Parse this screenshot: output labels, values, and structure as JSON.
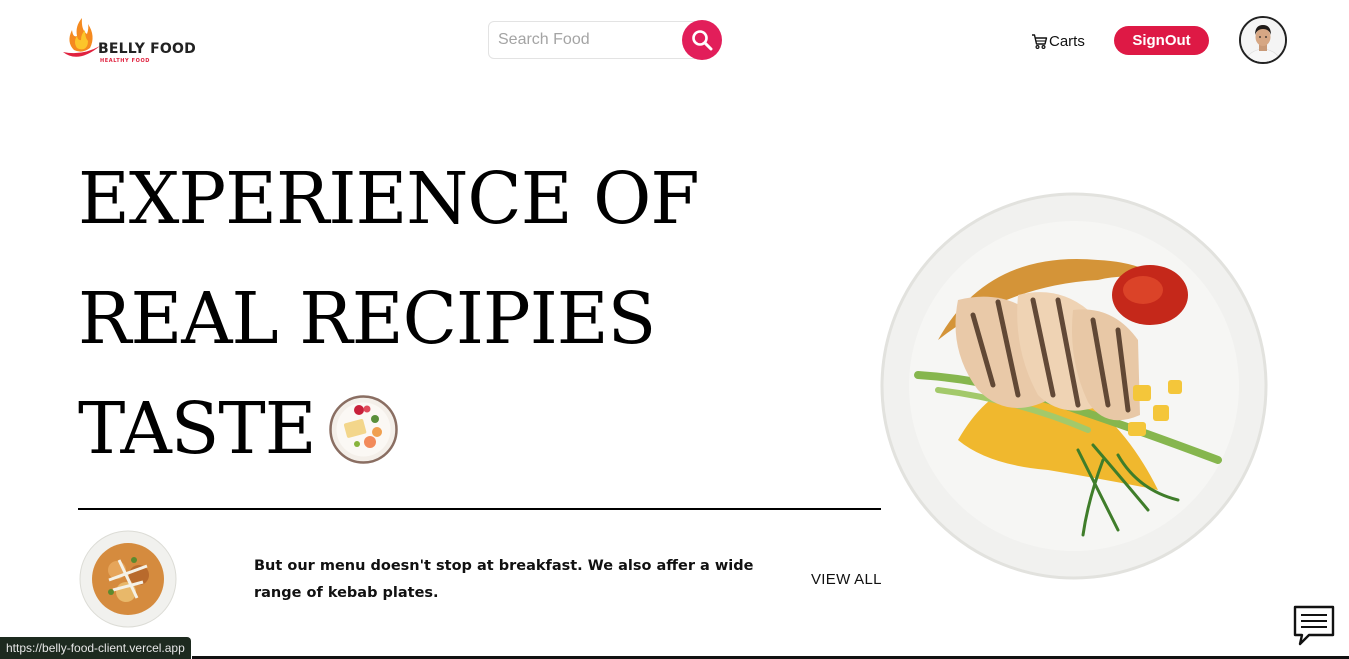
{
  "header": {
    "logo_text": "BELLY FOOD",
    "logo_tagline": "HEALTHY FOOD",
    "search": {
      "placeholder": "Search Food",
      "value": ""
    },
    "carts_label": "Carts",
    "signout_label": "SignOut"
  },
  "hero": {
    "line1": "EXPERIENCE OF",
    "line2": "REAL RECIPIES",
    "line3": "TASTE"
  },
  "menu": {
    "description": "But our menu doesn't stop at breakfast. We also affer a wide range of kebab plates.",
    "view_all_label": "VIEW ALL"
  },
  "status_bar": {
    "url": "https://belly-food-client.vercel.app"
  },
  "icons": {
    "search": "search-icon",
    "cart": "cart-icon",
    "chat": "chat-icon"
  },
  "colors": {
    "accent": "#e21e5a",
    "signout": "#de1945",
    "text": "#111111"
  }
}
